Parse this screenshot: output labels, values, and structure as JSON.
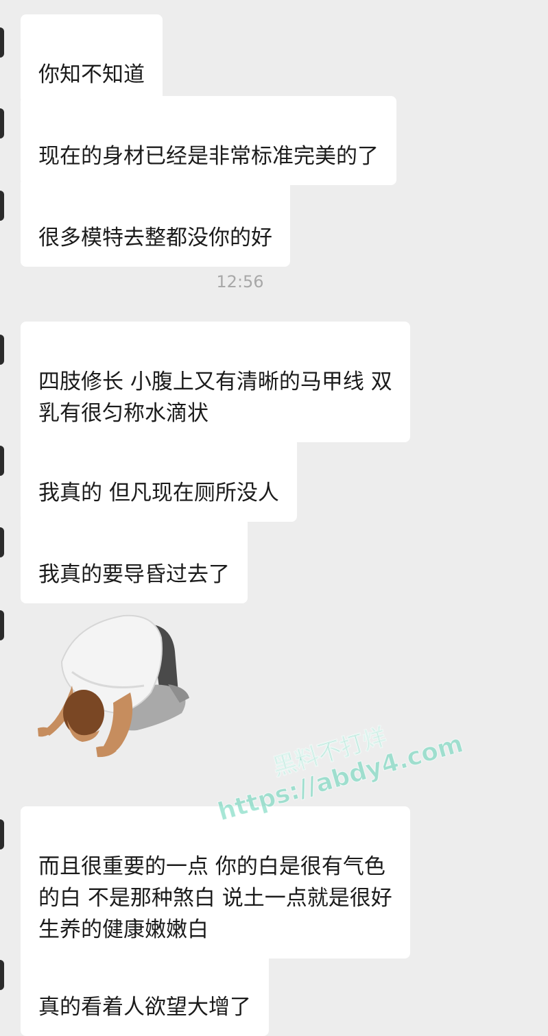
{
  "chat": {
    "timestamp": "12:56",
    "messages": [
      {
        "text": "你知不知道"
      },
      {
        "text": "现在的身材已经是非常标准完美的了"
      },
      {
        "text": "很多模特去整都没你的好"
      },
      {
        "text": "四肢修长 小腹上又有清晰的马甲线 双\n乳有很匀称水滴状"
      },
      {
        "text": "我真的 但凡现在厕所没人"
      },
      {
        "text": "我真的要导昏过去了"
      },
      {
        "text": "而且很重要的一点 你的白是很有气色\n的白 不是那种煞白 说土一点就是很好\n生养的健康嫩嫩白"
      },
      {
        "text": "真的看着人欲望大增了"
      }
    ],
    "sticker_icon": "kneeling-bowing-man-sticker"
  },
  "watermark": {
    "line1": "黑料不打烊",
    "line2": "https://abdy4.com"
  },
  "colors": {
    "background": "#ededed",
    "bubble": "#ffffff",
    "text": "#1b1b1b",
    "timestamp": "#a8a8a8",
    "watermark": "#5fd2b4"
  }
}
